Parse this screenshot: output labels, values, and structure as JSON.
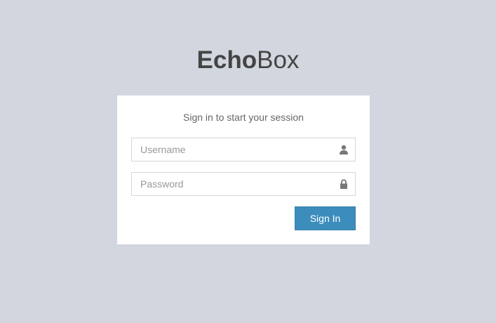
{
  "logo": {
    "bold": "Echo",
    "light": "Box"
  },
  "login": {
    "message": "Sign in to start your session",
    "username": {
      "placeholder": "Username",
      "value": "",
      "icon": "user-icon"
    },
    "password": {
      "placeholder": "Password",
      "value": "",
      "icon": "lock-icon"
    },
    "submit_label": "Sign In"
  },
  "colors": {
    "background": "#d2d6de",
    "primary": "#3c8dbc",
    "text": "#444444"
  }
}
